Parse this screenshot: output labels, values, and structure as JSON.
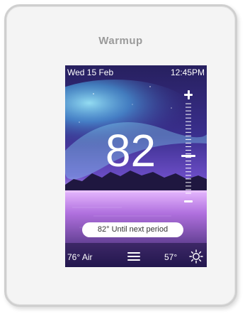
{
  "device": {
    "brand": "Warmup"
  },
  "status_bar": {
    "date": "Wed 15 Feb",
    "time": "12:45PM"
  },
  "temperature": {
    "setpoint": "82",
    "setpoint_level": 0.42
  },
  "controls": {
    "increase_icon": "plus-icon",
    "decrease_icon": "minus-icon"
  },
  "schedule": {
    "message": "82° Until next period"
  },
  "bottom_bar": {
    "air_temp": "76° Air",
    "menu_icon": "hamburger-menu-icon",
    "outdoor_temp": "57°",
    "weather_icon": "sun-icon"
  },
  "colors": {
    "sky_top": "#2c2470",
    "sky_mid": "#5a3fb4",
    "aurora": "#7ad7ff",
    "horizon_glow": "#e8c4ff",
    "water": "#b36bd8",
    "frame": "#cfcfcf",
    "text": "#ffffff"
  }
}
